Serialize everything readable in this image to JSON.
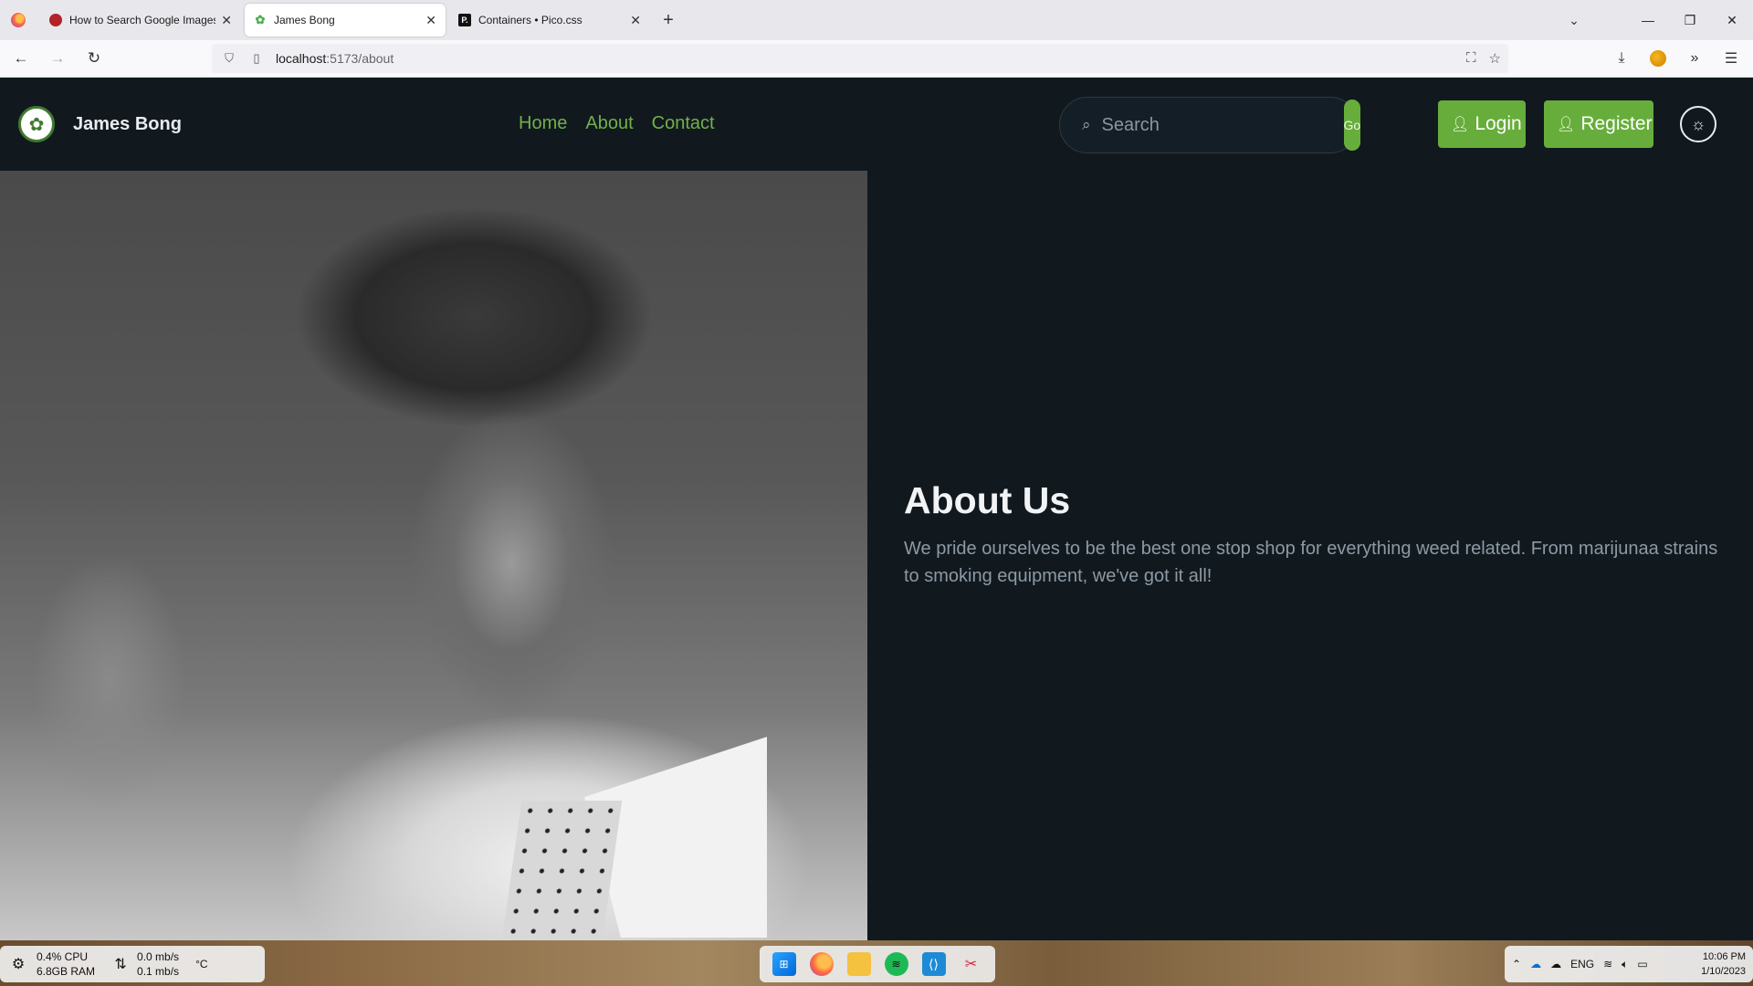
{
  "browser": {
    "tabs": [
      {
        "title": "How to Search Google Images f",
        "favicon": "red-circle-icon"
      },
      {
        "title": "James Bong",
        "favicon": "leaf-icon",
        "active": true
      },
      {
        "title": "Containers • Pico.css",
        "favicon": "pico-icon"
      }
    ],
    "url_host": "localhost",
    "url_path": ":5173/about"
  },
  "site": {
    "brand_name": "James Bong",
    "nav": [
      "Home",
      "About",
      "Contact"
    ],
    "search_placeholder": "Search",
    "search_go_label": "Go",
    "login_label": "Login",
    "register_label": "Register",
    "accent_color": "#67ad3b",
    "background_color": "#11191f"
  },
  "about": {
    "heading": "About Us",
    "body": "We pride ourselves to be the best one stop shop for everything weed related.  From marijunaa strains to smoking equipment, we've got it all!"
  },
  "taskbar": {
    "cpu": "0.4% CPU",
    "ram": "6.8GB  RAM",
    "net_down": "0.0 mb/s",
    "net_up": "0.1 mb/s",
    "temp_unit": "°C",
    "lang": "ENG",
    "time": "10:06 PM",
    "date": "1/10/2023"
  }
}
